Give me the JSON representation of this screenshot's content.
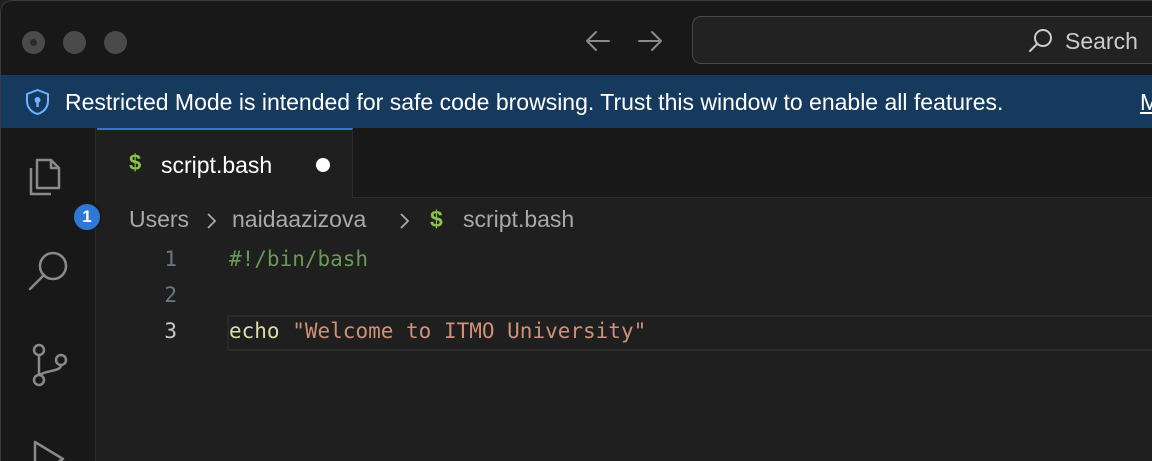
{
  "titlebar": {
    "search_label": "Search"
  },
  "banner": {
    "text": "Restricted Mode is intended for safe code browsing. Trust this window to enable all features.",
    "link": "M"
  },
  "activity": {
    "explorer_badge": "1"
  },
  "tabs": [
    {
      "icon": "$",
      "label": "script.bash",
      "dirty": true
    }
  ],
  "breadcrumb": {
    "items": [
      "Users",
      "naidaazizova",
      "script.bash"
    ],
    "file_icon": "$"
  },
  "editor": {
    "lines": [
      {
        "number": "1",
        "text": "#!/bin/bash"
      },
      {
        "number": "2",
        "text": ""
      },
      {
        "number": "3",
        "cmd": "echo",
        "arg": "\"Welcome to ITMO University\""
      }
    ],
    "current_line": 3
  },
  "colors": {
    "accent": "#2f78d4",
    "banner_bg": "#163a5e",
    "bash_icon": "#8dc149",
    "string": "#ce9178",
    "comment": "#6a9955"
  }
}
